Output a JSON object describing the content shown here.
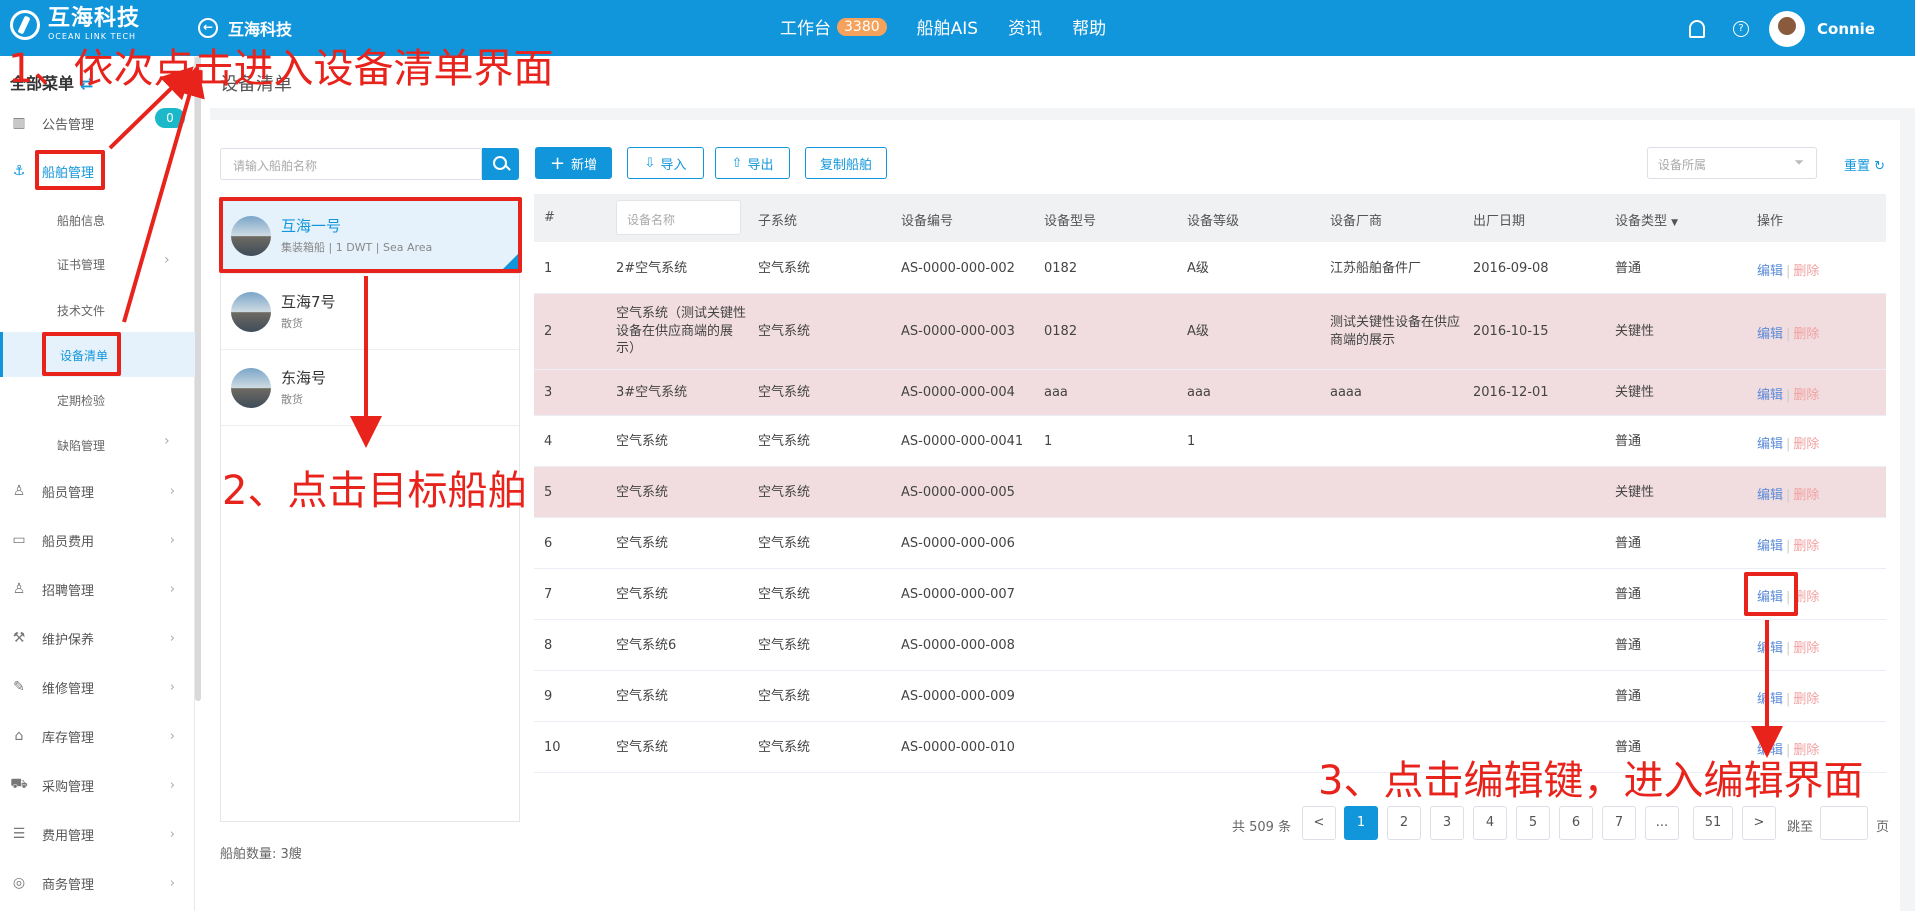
{
  "header": {
    "logo_cn": "互海科技",
    "logo_en": "OCEAN LINK TECH",
    "back_label": "互海科技",
    "nav": [
      {
        "label": "工作台",
        "badge": "3380"
      },
      {
        "label": "船舶AIS"
      },
      {
        "label": "资讯"
      },
      {
        "label": "帮助"
      }
    ],
    "user": "Connie",
    "help_glyph": "?"
  },
  "sidebar": {
    "title": "全部菜单",
    "swap_glyph": "⇄",
    "badge": "0",
    "items": [
      {
        "label": "公告管理",
        "icon": "book-icon",
        "glyph": "▥"
      },
      {
        "label": "船舶管理",
        "icon": "anchor-icon",
        "glyph": "⚓"
      },
      {
        "label": "船舶信息"
      },
      {
        "label": "证书管理"
      },
      {
        "label": "技术文件"
      },
      {
        "label": "设备清单"
      },
      {
        "label": "定期检验"
      },
      {
        "label": "缺陷管理"
      },
      {
        "label": "船员管理",
        "icon": "user-icon",
        "glyph": "♙"
      },
      {
        "label": "船员费用",
        "icon": "wallet-icon",
        "glyph": "▭"
      },
      {
        "label": "招聘管理",
        "icon": "recruit-icon",
        "glyph": "♙"
      },
      {
        "label": "维护保养",
        "icon": "hammer-icon",
        "glyph": "⚒"
      },
      {
        "label": "维修管理",
        "icon": "wrench-icon",
        "glyph": "✎"
      },
      {
        "label": "库存管理",
        "icon": "home-icon",
        "glyph": "⌂"
      },
      {
        "label": "采购管理",
        "icon": "cart-icon",
        "glyph": "⛟"
      },
      {
        "label": "费用管理",
        "icon": "coins-icon",
        "glyph": "☰"
      },
      {
        "label": "商务管理",
        "icon": "globe-icon",
        "glyph": "◎"
      }
    ]
  },
  "page": {
    "title": "设备清单"
  },
  "ships": {
    "search_placeholder": "请输入船舶名称",
    "list": [
      {
        "name": "互海一号",
        "sub": "集装箱船 | 1 DWT | Sea Area"
      },
      {
        "name": "互海7号",
        "sub": "散货"
      },
      {
        "name": "东海号",
        "sub": "散货"
      }
    ],
    "count": "船舶数量: 3艘"
  },
  "toolbar": {
    "add": "新增",
    "add_glyph": "+",
    "import": "导入",
    "import_glyph": "⇩",
    "export": "导出",
    "export_glyph": "⇧",
    "copy": "复制船舶",
    "filter_placeholder": "设备所属",
    "filter_glyph": "⏷",
    "reset": "重置",
    "reset_glyph": "↻"
  },
  "table": {
    "headers": [
      "#",
      "设备名称",
      "子系统",
      "设备编号",
      "设备型号",
      "设备等级",
      "设备厂商",
      "出厂日期",
      "设备类型",
      "操作"
    ],
    "type_sort_glyph": "▼",
    "rows": [
      {
        "idx": "1",
        "name": "2#空气系统",
        "sub": "空气系统",
        "code": "AS-0000-000-002",
        "model": "0182",
        "level": "A级",
        "maker": "江苏船舶备件厂",
        "date": "2016-09-08",
        "type": "普通",
        "edit": "编辑",
        "del": "删除"
      },
      {
        "idx": "2",
        "name": "空气系统（测试关键性设备在供应商端的展示）",
        "sub": "空气系统",
        "code": "AS-0000-000-003",
        "model": "0182",
        "level": "A级",
        "maker": "测试关键性设备在供应商端的展示",
        "date": "2016-10-15",
        "type": "关键性",
        "edit": "编辑",
        "del": "删除"
      },
      {
        "idx": "3",
        "name": "3#空气系统",
        "sub": "空气系统",
        "code": "AS-0000-000-004",
        "model": "aaa",
        "level": "aaa",
        "maker": "aaaa",
        "date": "2016-12-01",
        "type": "关键性",
        "edit": "编辑",
        "del": "删除"
      },
      {
        "idx": "4",
        "name": "空气系统",
        "sub": "空气系统",
        "code": "AS-0000-000-0041",
        "model": "1",
        "level": "1",
        "maker": "",
        "date": "",
        "type": "普通",
        "edit": "编辑",
        "del": "删除"
      },
      {
        "idx": "5",
        "name": "空气系统",
        "sub": "空气系统",
        "code": "AS-0000-000-005",
        "model": "",
        "level": "",
        "maker": "",
        "date": "",
        "type": "关键性",
        "edit": "编辑",
        "del": "删除"
      },
      {
        "idx": "6",
        "name": "空气系统",
        "sub": "空气系统",
        "code": "AS-0000-000-006",
        "model": "",
        "level": "",
        "maker": "",
        "date": "",
        "type": "普通",
        "edit": "编辑",
        "del": "删除"
      },
      {
        "idx": "7",
        "name": "空气系统",
        "sub": "空气系统",
        "code": "AS-0000-000-007",
        "model": "",
        "level": "",
        "maker": "",
        "date": "",
        "type": "普通",
        "edit": "编辑",
        "del": "删除"
      },
      {
        "idx": "8",
        "name": "空气系统6",
        "sub": "空气系统",
        "code": "AS-0000-000-008",
        "model": "",
        "level": "",
        "maker": "",
        "date": "",
        "type": "普通",
        "edit": "编辑",
        "del": "删除"
      },
      {
        "idx": "9",
        "name": "空气系统",
        "sub": "空气系统",
        "code": "AS-0000-000-009",
        "model": "",
        "level": "",
        "maker": "",
        "date": "",
        "type": "普通",
        "edit": "编辑",
        "del": "删除"
      },
      {
        "idx": "10",
        "name": "空气系统",
        "sub": "空气系统",
        "code": "AS-0000-000-010",
        "model": "",
        "level": "",
        "maker": "",
        "date": "",
        "type": "普通",
        "edit": "编辑",
        "del": "删除"
      }
    ]
  },
  "pagination": {
    "total": "共 509 条",
    "prev": "<",
    "pages": [
      "1",
      "2",
      "3",
      "4",
      "5",
      "6",
      "7",
      "...",
      "51"
    ],
    "next": ">",
    "goto": "跳至",
    "page_unit": "页"
  },
  "annotations": {
    "step1": "1、依次点击进入设备清单界面",
    "step2": "2、点击目标船舶",
    "step3": "3、点击编辑键，进入编辑界面"
  },
  "colors": {
    "brand": "#1296db",
    "highlight_row": "#f1dde0",
    "annotation": "#e8231c"
  }
}
